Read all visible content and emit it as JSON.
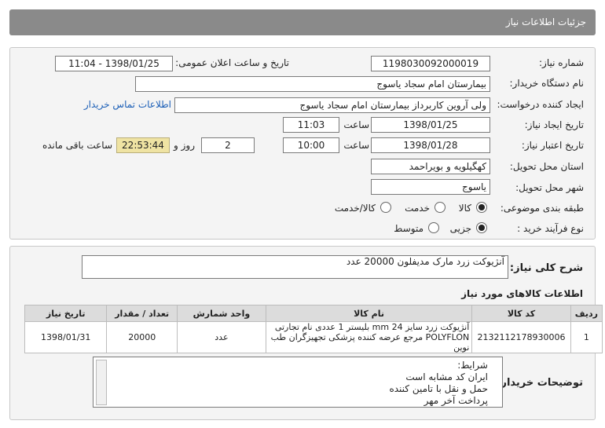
{
  "header": {
    "title": "جزئیات اطلاعات نیاز"
  },
  "form": {
    "need_number_label": "شماره نیاز:",
    "need_number": "1198030092000019",
    "announce_label": "تاریخ و ساعت اعلان عمومی:",
    "announce_value": "1398/01/25 - 11:04",
    "buyer_org_label": "نام دستگاه خریدار:",
    "buyer_org": "بیمارستان امام سجاد یاسوج",
    "requester_label": "ایجاد کننده درخواست:",
    "requester": "ولی آروین کاربرداز بیمارستان امام سجاد یاسوج",
    "contact_link": "اطلاعات تماس خریدار",
    "created_label": "تاریخ ایجاد نیاز:",
    "created_date": "1398/01/25",
    "time_label": "ساعت",
    "created_time": "11:03",
    "validity_label": "تاریخ اعتبار نیاز:",
    "validity_date": "1398/01/28",
    "validity_time": "10:00",
    "day_label": "روز و",
    "days": "2",
    "remaining_time": "22:53:44",
    "remaining_label": "ساعت باقی مانده",
    "province_label": "استان محل تحویل:",
    "province": "کهگیلویه و بویراحمد",
    "city_label": "شهر محل تحویل:",
    "city": "یاسوج",
    "category_label": "طبقه بندی موضوعی:",
    "category_options": [
      "کالا",
      "خدمت",
      "کالا/خدمت"
    ],
    "category_selected": 0,
    "process_label": "نوع فرآیند خرید :",
    "process_options": [
      "جزیی",
      "متوسط"
    ],
    "process_selected": 0
  },
  "summary": {
    "label": "شرح کلی نیاز:",
    "text": "آنژیوکت زرد مارک مدیفلون 20000 عدد"
  },
  "items_section": {
    "title": "اطلاعات کالاهای مورد نیاز",
    "columns": [
      "ردیف",
      "کد کالا",
      "نام کالا",
      "واحد شمارش",
      "تعداد / مقدار",
      "تاریخ نیاز"
    ],
    "rows": [
      {
        "index": "1",
        "code": "2132112178930006",
        "name_line1": "آنژیوکت زرد سایز mm 24 بلیستر 1 عددی نام تجارتی",
        "name_line2": "POLYFLON مرجع عرضه کننده پزشکی تجهیزگران طب نوین",
        "unit": "عدد",
        "qty": "20000",
        "date": "1398/01/31"
      }
    ]
  },
  "buyer_notes": {
    "label": "توضیحات خریدار:",
    "lines": [
      "شرایط:",
      "ایران کد مشابه است",
      "حمل و نقل با تامین کننده",
      "پرداخت آخر مهر"
    ]
  }
}
